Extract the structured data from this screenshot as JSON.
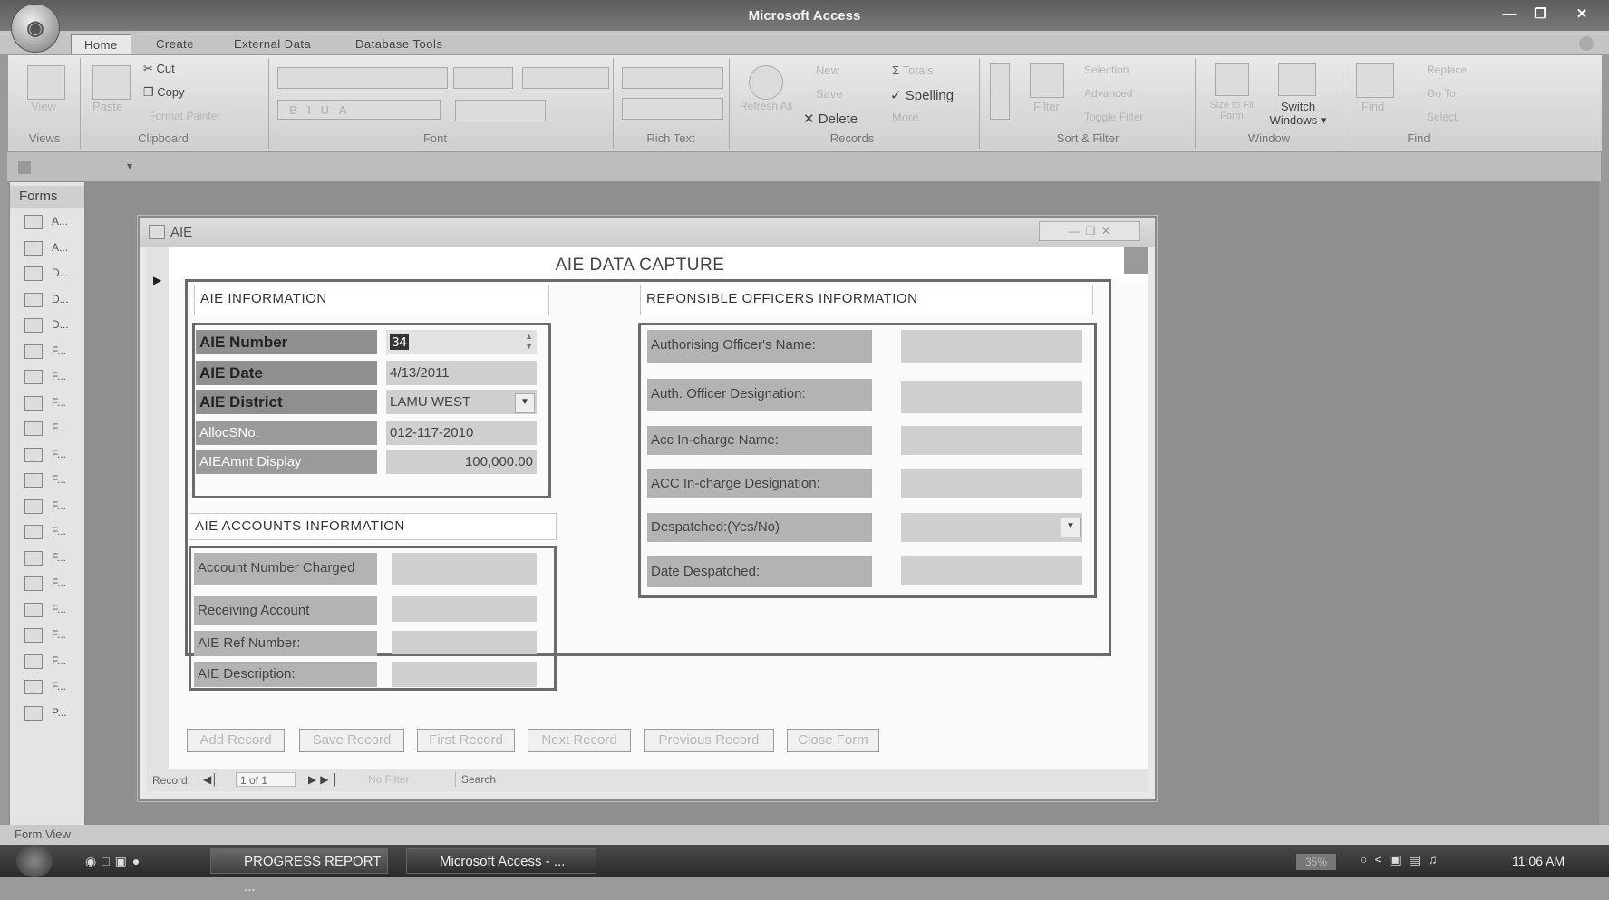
{
  "window": {
    "title": "Microsoft Access"
  },
  "tabs": [
    {
      "label": "Home"
    },
    {
      "label": "Create"
    },
    {
      "label": "External Data"
    },
    {
      "label": "Database Tools"
    }
  ],
  "ribbon": {
    "views": {
      "view": "View",
      "label": "Views"
    },
    "clipboard": {
      "paste": "Paste",
      "cut": "Cut",
      "copy": "Copy",
      "format_painter": "Format Painter",
      "label": "Clipboard"
    },
    "font": {
      "label": "Font"
    },
    "rich_text": {
      "label": "Rich Text"
    },
    "records": {
      "refresh": "Refresh All",
      "new": "New",
      "save": "Save",
      "delete": "Delete",
      "totals": "Totals",
      "spelling": "Spelling",
      "more": "More",
      "label": "Records"
    },
    "sort_filter": {
      "filter": "Filter",
      "selection": "Selection",
      "advanced": "Advanced",
      "toggle_filter": "Toggle Filter",
      "label": "Sort & Filter"
    },
    "window": {
      "size_to_fit": "Size to Fit Form",
      "switch_windows_line1": "Switch",
      "switch_windows_line2": "Windows",
      "label": "Window"
    },
    "find": {
      "find": "Find",
      "replace": "Replace",
      "goto": "Go To",
      "select": "Select",
      "label": "Find"
    }
  },
  "nav": {
    "header": "Forms",
    "items": [
      "A...",
      "A...",
      "D...",
      "D...",
      "D...",
      "F...",
      "F...",
      "F...",
      "F...",
      "F...",
      "F...",
      "F...",
      "F...",
      "F...",
      "F...",
      "F...",
      "F...",
      "F...",
      "F...",
      "P..."
    ]
  },
  "form": {
    "window_title": "AIE",
    "header": "AIE DATA CAPTURE",
    "aie_info": {
      "title": "AIE INFORMATION",
      "number_label": "AIE Number",
      "number_value": "34",
      "date_label": "AIE  Date",
      "date_value": "4/13/2011",
      "district_label": "AIE District",
      "district_value": "LAMU WEST",
      "allocsno_label": "AllocSNo:",
      "allocsno_value": "012-117-2010",
      "amount_label": "AIEAmnt Display",
      "amount_value": "100,000.00"
    },
    "accounts_info": {
      "title": "AIE ACCOUNTS INFORMATION",
      "account_charged": "Account Number Charged",
      "receiving_account": "Receiving  Account",
      "ref_number": "AIE Ref Number:",
      "description": "AIE  Description:"
    },
    "officers_info": {
      "title": "REPONSIBLE OFFICERS INFORMATION",
      "auth_name": "Authorising Officer's  Name:",
      "auth_designation": "Auth. Officer Designation:",
      "acc_name": "Acc  In-charge Name:",
      "acc_designation": "ACC In-charge Designation:",
      "despatched": "Despatched:(Yes/No)",
      "date_despatched": "Date Despatched:"
    },
    "buttons": {
      "add": "Add Record",
      "save": "Save Record",
      "first": "First Record",
      "next": "Next Record",
      "previous": "Previous Record",
      "close": "Close Form"
    },
    "record_nav": {
      "label": "Record:",
      "position": "1 of 1",
      "filter": "No Filter",
      "search": "Search"
    }
  },
  "status": {
    "view": "Form View"
  },
  "taskbar": {
    "item1": "PROGRESS REPORT ...",
    "item2": "Microsoft Access - ...",
    "zoom": "35%",
    "time": "11:06 AM"
  }
}
